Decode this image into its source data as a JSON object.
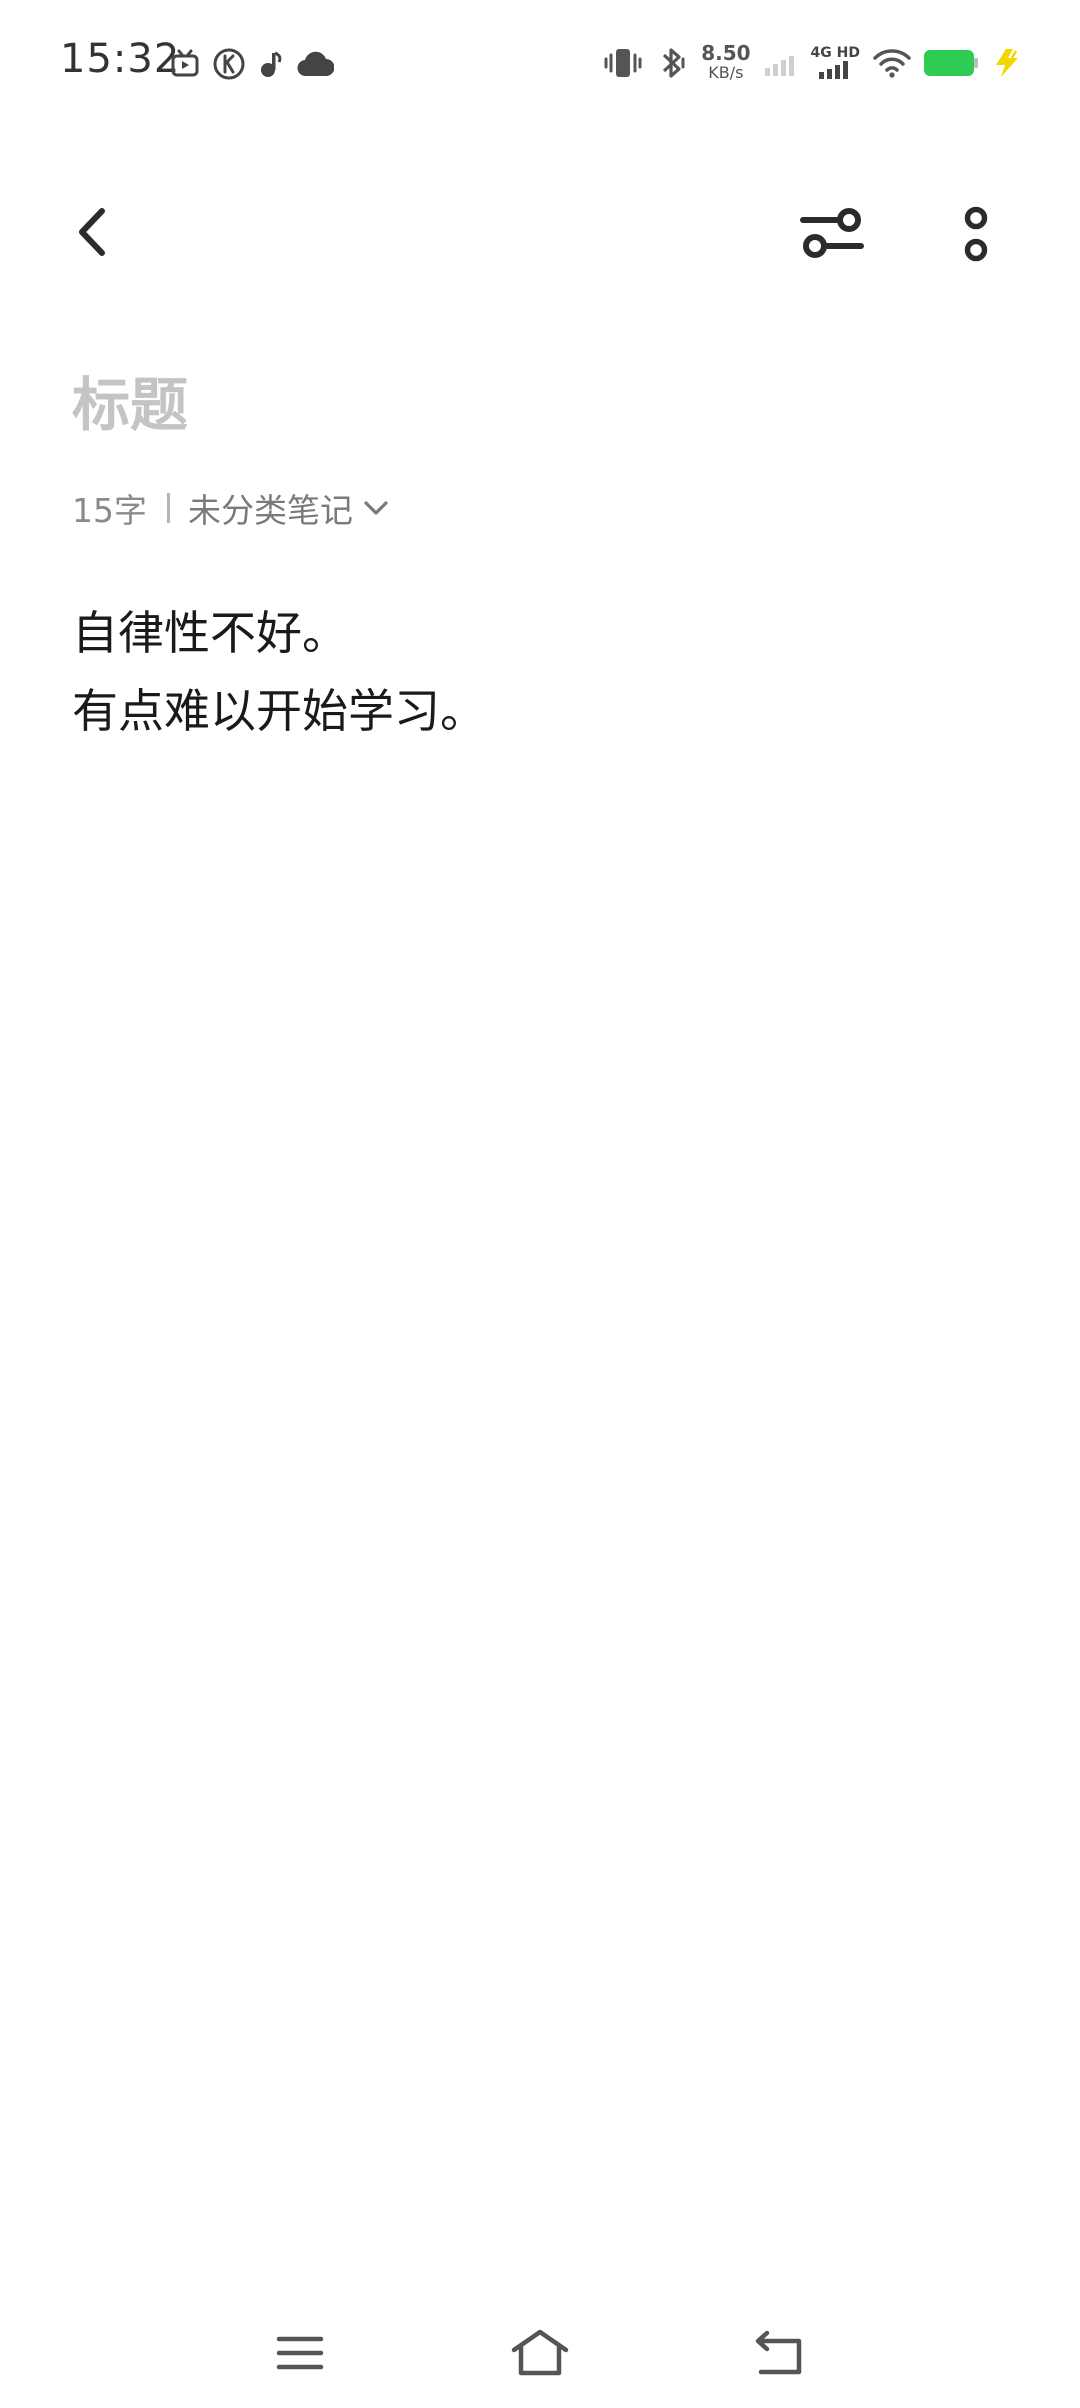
{
  "status_bar": {
    "time": "15:32",
    "net_speed_value": "8.50",
    "net_speed_unit": "KB/s",
    "network_type": "4G",
    "hd_label": "HD",
    "battery_color": "#2ecc52",
    "charging_color": "#f2d600",
    "left_icons": [
      "tv-icon",
      "k-circle-icon",
      "music-note-icon",
      "cloud-icon"
    ],
    "right_icons": [
      "vibrate-icon",
      "bluetooth-icon",
      "signal-sim1-icon",
      "signal-sim2-icon",
      "wifi-icon",
      "battery-icon",
      "charging-bolt-icon"
    ]
  },
  "toolbar": {
    "back_icon": "chevron-left-icon",
    "settings_icon": "sliders-icon",
    "more_icon": "more-vertical-icon"
  },
  "note": {
    "title_value": "",
    "title_placeholder": "标题",
    "char_count": "15字",
    "category": "未分类笔记",
    "lines": [
      "自律性不好。",
      "有点难以开始学习。"
    ]
  },
  "nav_bar": {
    "menu_icon": "menu-icon",
    "home_icon": "home-icon",
    "back_icon": "back-arrow-icon"
  }
}
